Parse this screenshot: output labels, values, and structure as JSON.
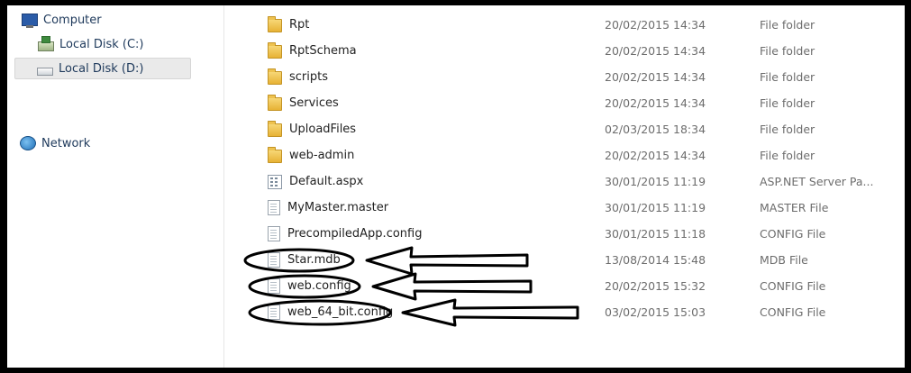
{
  "nav": {
    "items": [
      {
        "label": "Computer",
        "icon": "computer-icon",
        "selected": false
      },
      {
        "label": "Local Disk (C:)",
        "icon": "local-disk-c-icon",
        "selected": false
      },
      {
        "label": "Local Disk (D:)",
        "icon": "local-disk-d-icon",
        "selected": true
      },
      {
        "label": "Network",
        "icon": "network-icon",
        "selected": false
      }
    ]
  },
  "files": [
    {
      "name": "Rpt",
      "date": "20/02/2015 14:34",
      "type": "File folder",
      "icon": "folder-icon"
    },
    {
      "name": "RptSchema",
      "date": "20/02/2015 14:34",
      "type": "File folder",
      "icon": "folder-icon"
    },
    {
      "name": "scripts",
      "date": "20/02/2015 14:34",
      "type": "File folder",
      "icon": "folder-icon"
    },
    {
      "name": "Services",
      "date": "20/02/2015 14:34",
      "type": "File folder",
      "icon": "folder-icon"
    },
    {
      "name": "UploadFiles",
      "date": "02/03/2015 18:34",
      "type": "File folder",
      "icon": "folder-icon"
    },
    {
      "name": "web-admin",
      "date": "20/02/2015 14:34",
      "type": "File folder",
      "icon": "folder-icon"
    },
    {
      "name": "Default.aspx",
      "date": "30/01/2015 11:19",
      "type": "ASP.NET Server Pa...",
      "icon": "aspx-file-icon"
    },
    {
      "name": "MyMaster.master",
      "date": "30/01/2015 11:19",
      "type": "MASTER File",
      "icon": "document-icon"
    },
    {
      "name": "PrecompiledApp.config",
      "date": "30/01/2015 11:18",
      "type": "CONFIG File",
      "icon": "document-icon"
    },
    {
      "name": "Star.mdb",
      "date": "13/08/2014 15:48",
      "type": "MDB File",
      "icon": "document-icon"
    },
    {
      "name": "web.config",
      "date": "20/02/2015 15:32",
      "type": "CONFIG File",
      "icon": "document-icon"
    },
    {
      "name": "web_64_bit.config",
      "date": "03/02/2015 15:03",
      "type": "CONFIG File",
      "icon": "document-icon"
    }
  ],
  "annotation": {
    "color": "#000000",
    "highlighted_files": [
      "Star.mdb",
      "web.config",
      "web_64_bit.config"
    ]
  }
}
